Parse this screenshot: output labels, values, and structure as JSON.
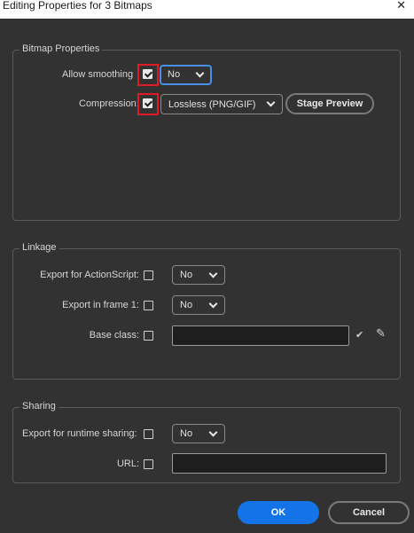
{
  "window": {
    "title": "Editing Properties for 3 Bitmaps",
    "close_glyph": "✕"
  },
  "bitmap": {
    "legend": "Bitmap Properties",
    "allow_smoothing": {
      "label": "Allow smoothing",
      "checked": true,
      "value": "No"
    },
    "compression": {
      "label": "Compression:",
      "checked": true,
      "value": "Lossless (PNG/GIF)"
    },
    "stage_preview_label": "Stage Preview"
  },
  "linkage": {
    "legend": "Linkage",
    "export_actionscript": {
      "label": "Export for ActionScript:",
      "checked": false,
      "value": "No"
    },
    "export_frame1": {
      "label": "Export in frame 1:",
      "checked": false,
      "value": "No"
    },
    "base_class": {
      "label": "Base class:",
      "checked": false,
      "value": ""
    }
  },
  "sharing": {
    "legend": "Sharing",
    "export_runtime": {
      "label": "Export for runtime sharing:",
      "checked": false,
      "value": "No"
    },
    "url": {
      "label": "URL:",
      "checked": false,
      "value": ""
    }
  },
  "footer": {
    "ok_label": "OK",
    "cancel_label": "Cancel"
  },
  "colors": {
    "accent": "#1473e6",
    "highlight": "#e01b24",
    "focus": "#4a8fe7",
    "background": "#323232"
  }
}
